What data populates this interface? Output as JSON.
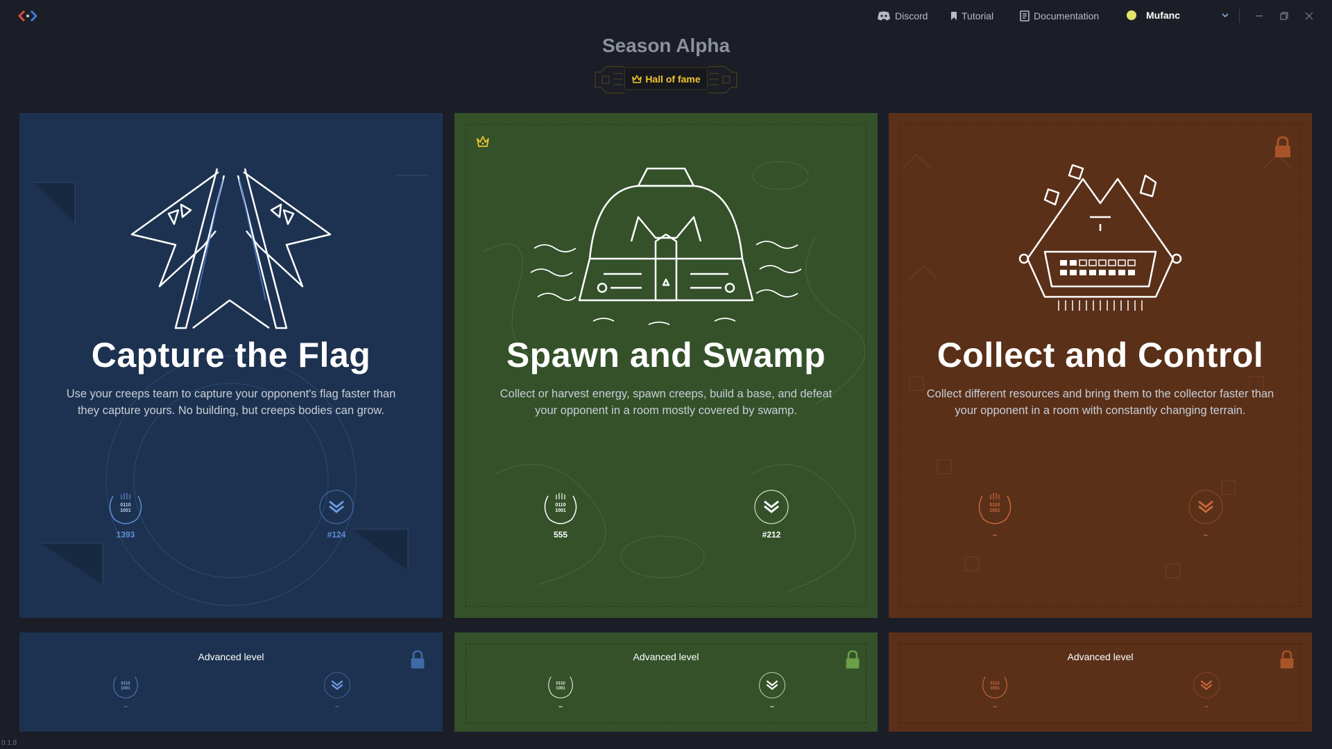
{
  "colors": {
    "background": "#1b1e27",
    "blue_card": "#1d3250",
    "green_card": "#34512a",
    "orange_card": "#5a3019",
    "gold": "#f2c531",
    "user_status": "#e3e46a"
  },
  "header": {
    "nav": [
      {
        "label": "Discord",
        "icon": "discord-icon"
      },
      {
        "label": "Tutorial",
        "icon": "bookmark-icon"
      },
      {
        "label": "Documentation",
        "icon": "document-icon"
      }
    ],
    "user": {
      "name": "Mufanc",
      "status_icon": "status-dot-icon",
      "menu_icon": "chevron-down-icon"
    },
    "window_controls": [
      "minimize-icon",
      "restore-icon",
      "close-icon"
    ]
  },
  "season": {
    "title": "Season Alpha",
    "hall_of_fame": "Hall of fame"
  },
  "modes": [
    {
      "title": "Capture the Flag",
      "description": "Use your creeps team to capture your opponent's flag faster than they capture yours. No building, but creeps bodies can grow.",
      "score": "1393",
      "rank": "#124",
      "badge_code": "0110\n1001",
      "crowned": false,
      "locked": false,
      "advanced": {
        "label": "Advanced level",
        "score": "–",
        "rank": "–",
        "locked": true
      }
    },
    {
      "title": "Spawn and Swamp",
      "description": "Collect or harvest energy, spawn creeps, build a base, and defeat your opponent in a room mostly covered by swamp.",
      "score": "555",
      "rank": "#212",
      "badge_code": "0110\n1001",
      "crowned": true,
      "locked": false,
      "advanced": {
        "label": "Advanced level",
        "score": "–",
        "rank": "–",
        "locked": true
      }
    },
    {
      "title": "Collect and Control",
      "description": "Collect different resources and bring them to the collector faster than your opponent in a room with constantly changing terrain.",
      "score": "–",
      "rank": "–",
      "badge_code": "0110\n1001",
      "crowned": false,
      "locked": true,
      "advanced": {
        "label": "Advanced level",
        "score": "–",
        "rank": "–",
        "locked": true
      }
    }
  ],
  "version": "0.1.8"
}
